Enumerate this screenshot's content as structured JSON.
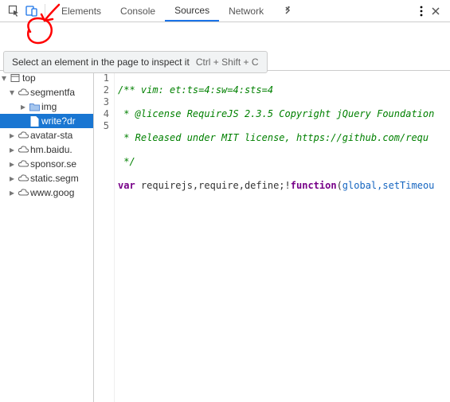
{
  "toolbar": {
    "inspect_tooltip": "Select an element in the page to inspect it",
    "inspect_shortcut": "Ctrl + Shift + C"
  },
  "tabs": {
    "elements": "Elements",
    "console": "Console",
    "sources": "Sources",
    "network": "Network"
  },
  "tree": {
    "top": "top",
    "segmentfault": "segmentfa",
    "img_folder": "img",
    "write_file": "write?dr",
    "avatar": "avatar-sta",
    "hm_baidu": "hm.baidu.",
    "sponsor": "sponsor.se",
    "static_segment": "static.segm",
    "www_google": "www.goog"
  },
  "code": {
    "line_numbers": [
      "1",
      "2",
      "3",
      "4",
      "5"
    ],
    "line1": "/** vim: et:ts=4:sw=4:sts=4",
    "line2": " * @license RequireJS 2.3.5 Copyright jQuery Foundation",
    "line3": " * Released under MIT license, https://github.com/requ",
    "line4": " */",
    "line5_var": "var",
    "line5_names": " requirejs,require,define;",
    "line5_bang": "!",
    "line5_func": "function",
    "line5_paren_open": "(",
    "line5_args": "global,setTimeou",
    "line5_rest": ""
  }
}
